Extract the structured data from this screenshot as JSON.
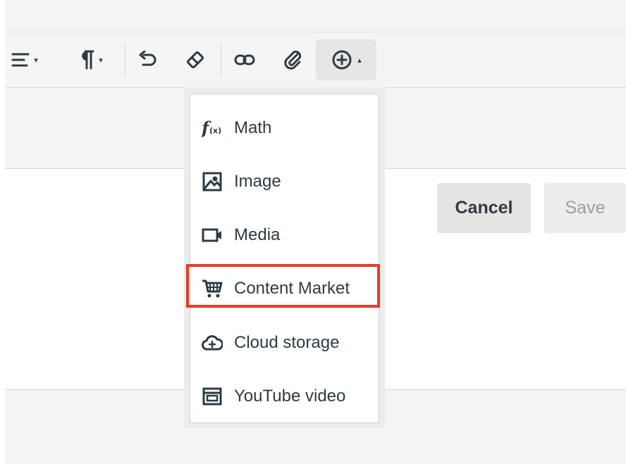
{
  "toolbar": {
    "items": [
      {
        "name": "align-icon",
        "caret": "▾"
      },
      {
        "name": "paragraph-icon",
        "caret": "▾"
      },
      {
        "name": "undo-icon"
      },
      {
        "name": "eraser-icon"
      },
      {
        "name": "link-icon"
      },
      {
        "name": "paperclip-icon"
      },
      {
        "name": "add-circle-icon",
        "caret": "▴",
        "active": true
      }
    ]
  },
  "insert_menu": {
    "items": [
      {
        "label": "Math",
        "icon": "function-icon"
      },
      {
        "label": "Image",
        "icon": "image-icon"
      },
      {
        "label": "Media",
        "icon": "video-camera-icon"
      },
      {
        "label": "Content Market",
        "icon": "cart-icon",
        "highlighted": true
      },
      {
        "label": "Cloud storage",
        "icon": "cloud-add-icon"
      },
      {
        "label": "YouTube video",
        "icon": "youtube-box-icon"
      }
    ]
  },
  "actions": {
    "cancel_label": "Cancel",
    "save_label": "Save"
  },
  "colors": {
    "highlight": "#e63b22",
    "text": "#2d3b45",
    "panel": "#f5f5f5"
  }
}
